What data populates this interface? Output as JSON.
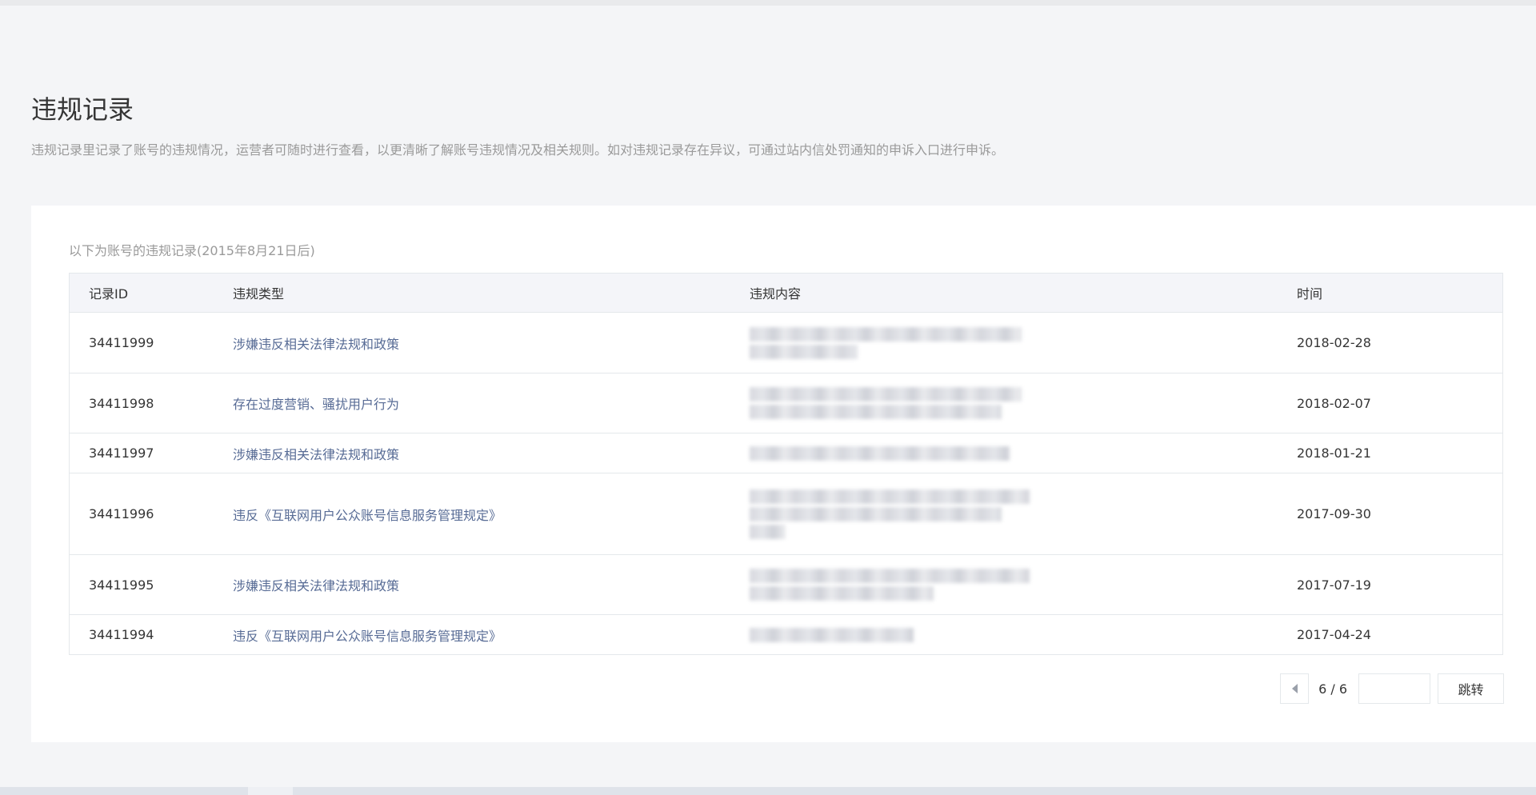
{
  "page": {
    "title": "违规记录",
    "description": "违规记录里记录了账号的违规情况，运营者可随时进行查看，以更清晰了解账号违规情况及相关规则。如对违规记录存在异议，可通过站内信处罚通知的申诉入口进行申诉。"
  },
  "card": {
    "subtitle": "以下为账号的违规记录(2015年8月21日后)"
  },
  "table": {
    "columns": {
      "id": "记录ID",
      "type": "违规类型",
      "content": "违规内容",
      "time": "时间"
    },
    "rows": [
      {
        "id": "34411999",
        "type": "涉嫌违反相关法律法规和政策",
        "time": "2018-02-28"
      },
      {
        "id": "34411998",
        "type": "存在过度营销、骚扰用户行为",
        "time": "2018-02-07"
      },
      {
        "id": "34411997",
        "type": "涉嫌违反相关法律法规和政策",
        "time": "2018-01-21"
      },
      {
        "id": "34411996",
        "type": "违反《互联网用户公众账号信息服务管理规定》",
        "time": "2017-09-30"
      },
      {
        "id": "34411995",
        "type": "涉嫌违反相关法律法规和政策",
        "time": "2017-07-19"
      },
      {
        "id": "34411994",
        "type": "违反《互联网用户公众账号信息服务管理规定》",
        "time": "2017-04-24"
      }
    ]
  },
  "pagination": {
    "page_display": "6 / 6",
    "jump_label": "跳转",
    "input_value": ""
  }
}
